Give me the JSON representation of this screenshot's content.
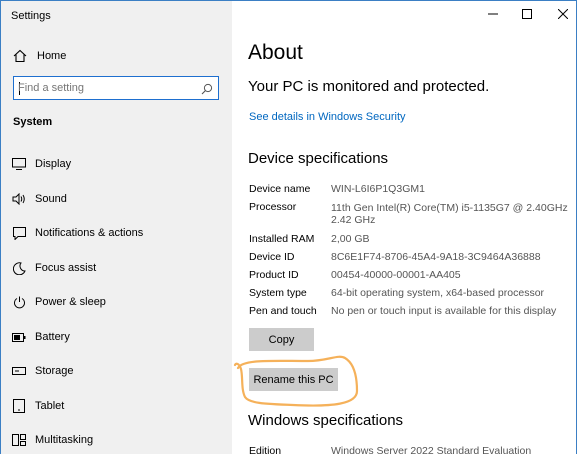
{
  "window": {
    "title": "Settings"
  },
  "sidebar": {
    "home_label": "Home",
    "search_placeholder": "Find a setting",
    "section_label": "System",
    "items": [
      {
        "label": "Display",
        "icon": "display-icon"
      },
      {
        "label": "Sound",
        "icon": "sound-icon"
      },
      {
        "label": "Notifications & actions",
        "icon": "notifications-icon"
      },
      {
        "label": "Focus assist",
        "icon": "focus-assist-icon"
      },
      {
        "label": "Power & sleep",
        "icon": "power-icon"
      },
      {
        "label": "Battery",
        "icon": "battery-icon"
      },
      {
        "label": "Storage",
        "icon": "storage-icon"
      },
      {
        "label": "Tablet",
        "icon": "tablet-icon"
      },
      {
        "label": "Multitasking",
        "icon": "multitasking-icon"
      }
    ]
  },
  "main": {
    "title": "About",
    "status": "Your PC is monitored and protected.",
    "security_link": "See details in Windows Security",
    "device_specs_heading": "Device specifications",
    "device_specs": [
      {
        "label": "Device name",
        "value": "WIN-L6I6P1Q3GM1"
      },
      {
        "label": "Processor",
        "value": "11th Gen Intel(R) Core(TM) i5-1135G7 @ 2.40GHz",
        "value2": "2.42 GHz"
      },
      {
        "label": "Installed RAM",
        "value": "2,00 GB"
      },
      {
        "label": "Device ID",
        "value": "8C6E1F74-8706-45A4-9A18-3C9464A36888"
      },
      {
        "label": "Product ID",
        "value": "00454-40000-00001-AA405"
      },
      {
        "label": "System type",
        "value": "64-bit operating system, x64-based processor"
      },
      {
        "label": "Pen and touch",
        "value": "No pen or touch input is available for this display"
      }
    ],
    "copy_button": "Copy",
    "rename_button": "Rename this PC",
    "windows_specs_heading": "Windows specifications",
    "windows_specs": [
      {
        "label": "Edition",
        "value": "Windows Server 2022 Standard Evaluation"
      }
    ]
  },
  "colors": {
    "accent": "#0067c0",
    "sidebar_bg": "#f0f0f0",
    "annotation": "#f5b15a",
    "button_bg": "#cccccc"
  }
}
